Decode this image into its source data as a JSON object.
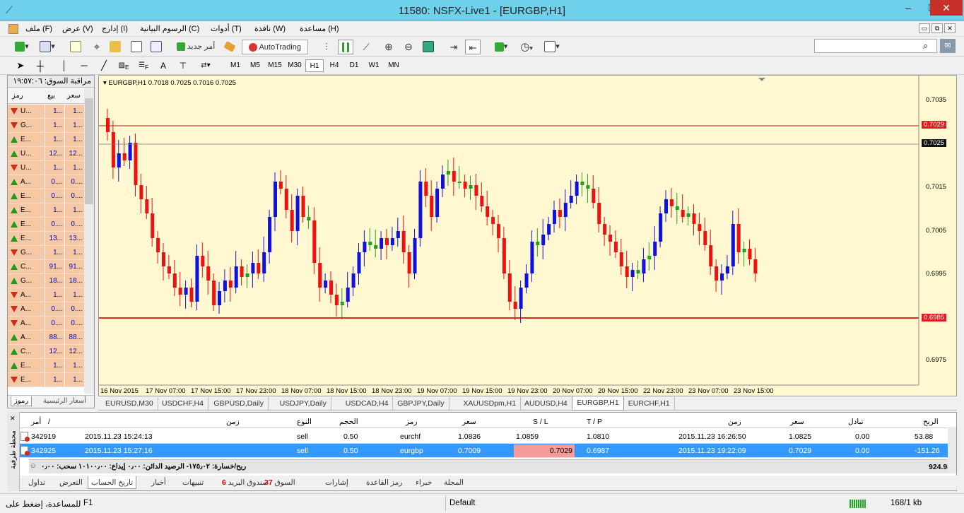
{
  "window": {
    "title": "11580: NSFX-Live1 - [EURGBP,H1]",
    "controls": [
      "–",
      "☐",
      "✕"
    ],
    "mdi_controls": [
      "▭",
      "⧉",
      "✕"
    ]
  },
  "menu": {
    "items": [
      "ملف (F)",
      "عرض (V)",
      "إدارج (I)",
      "الرسوم البيانية (C)",
      "أدوات (T)",
      "نافذة (W)",
      "مساعدة (H)"
    ]
  },
  "toolbar": {
    "new_order_label": "أمر جديد",
    "autotrading_label": "AutoTrading",
    "timeframes": [
      "M1",
      "M5",
      "M15",
      "M30",
      "H1",
      "H4",
      "D1",
      "W1",
      "MN"
    ],
    "selected_timeframe": "H1",
    "drawing_letters": [
      "E",
      "F",
      "A",
      "T"
    ]
  },
  "market_watch": {
    "header": "مراقبة السوق: ١٩:٥٧:٠٦",
    "columns": [
      "رمز",
      "بيع",
      "سعر"
    ],
    "rows": [
      {
        "sym": "U...",
        "bid": "1...",
        "ask": "1...",
        "dir": "dn"
      },
      {
        "sym": "G...",
        "bid": "1...",
        "ask": "1...",
        "dir": "dn"
      },
      {
        "sym": "E...",
        "bid": "1...",
        "ask": "1...",
        "dir": "up"
      },
      {
        "sym": "U...",
        "bid": "12...",
        "ask": "12...",
        "dir": "up"
      },
      {
        "sym": "U...",
        "bid": "1...",
        "ask": "1...",
        "dir": "dn"
      },
      {
        "sym": "A...",
        "bid": "0....",
        "ask": "0....",
        "dir": "up"
      },
      {
        "sym": "E...",
        "bid": "0....",
        "ask": "0....",
        "dir": "up"
      },
      {
        "sym": "E...",
        "bid": "1...",
        "ask": "1...",
        "dir": "up"
      },
      {
        "sym": "E...",
        "bid": "0....",
        "ask": "0....",
        "dir": "up"
      },
      {
        "sym": "E...",
        "bid": "13...",
        "ask": "13...",
        "dir": "up"
      },
      {
        "sym": "G...",
        "bid": "1...",
        "ask": "1...",
        "dir": "dn"
      },
      {
        "sym": "C...",
        "bid": "91...",
        "ask": "91...",
        "dir": "up"
      },
      {
        "sym": "G...",
        "bid": "18...",
        "ask": "18...",
        "dir": "up"
      },
      {
        "sym": "A...",
        "bid": "1...",
        "ask": "1...",
        "dir": "dn"
      },
      {
        "sym": "A...",
        "bid": "0....",
        "ask": "0....",
        "dir": "dn"
      },
      {
        "sym": "A...",
        "bid": "0....",
        "ask": "0....",
        "dir": "dn"
      },
      {
        "sym": "A...",
        "bid": "88...",
        "ask": "88...",
        "dir": "up"
      },
      {
        "sym": "C...",
        "bid": "12...",
        "ask": "12...",
        "dir": "up"
      },
      {
        "sym": "E...",
        "bid": "1...",
        "ask": "1...",
        "dir": "up"
      },
      {
        "sym": "E...",
        "bid": "1...",
        "ask": "1...",
        "dir": "dn"
      }
    ],
    "tabs": [
      "رموز",
      "أسعار الرئيسية"
    ]
  },
  "chart": {
    "header": "EURGBP,H1  0.7018 0.7025 0.7016 0.7025",
    "price_labels": [
      "0.7035",
      "0.7015",
      "0.7005",
      "0.6995",
      "0.6975"
    ],
    "level_sl": "0.7029",
    "level_current": "0.7025",
    "level_tp": "0.6985",
    "time_labels": [
      "16 Nov 2015",
      "17 Nov 07:00",
      "17 Nov 15:00",
      "17 Nov 23:00",
      "18 Nov 07:00",
      "18 Nov 15:00",
      "18 Nov 23:00",
      "19 Nov 07:00",
      "19 Nov 15:00",
      "19 Nov 23:00",
      "20 Nov 07:00",
      "20 Nov 15:00",
      "22 Nov 23:00",
      "23 Nov 07:00",
      "23 Nov 15:00"
    ],
    "colors": {
      "bull": "#1010e0",
      "bear": "#f01010",
      "doji": "#20a020",
      "bg": "#fff8d0",
      "level": "#d01010"
    }
  },
  "chart_tabs": [
    "EURUSD,M30",
    "USDCHF,H4",
    "GBPUSD,Daily",
    "USDJPY,Daily",
    "USDCAD,H4",
    "GBPJPY,Daily",
    "XAUUSDpm,H1",
    "AUDUSD,H4",
    "EURGBP,H1",
    "EURCHF,H1"
  ],
  "active_chart_tab": "EURGBP,H1",
  "terminal": {
    "columns": {
      "order": "أمر",
      "sort": "/",
      "time": "زمن",
      "type": "النوع",
      "volume": "الحجم",
      "symbol": "رمز",
      "price": "سعر",
      "sl": "S / L",
      "tp": "T / P",
      "time2": "زمن",
      "price2": "سعر",
      "swap": "تبادل",
      "profit": "الربح"
    },
    "rows": [
      {
        "order": "342919",
        "time": "2015.11.23 15:24:13",
        "type": "sell",
        "volume": "0.50",
        "symbol": "eurchf",
        "price": "1.0836",
        "sl": "1.0859",
        "tp": "1.0810",
        "time2": "2015.11.23 16:26:50",
        "price2": "1.0825",
        "swap": "0.00",
        "profit": "53.88"
      },
      {
        "order": "342925",
        "time": "2015.11.23 15:27:16",
        "type": "sell",
        "volume": "0.50",
        "symbol": "eurgbp",
        "price": "0.7009",
        "sl": "0.7029",
        "tp": "0.6987",
        "time2": "2015.11.23 19:22:09",
        "price2": "0.7029",
        "swap": "0.00",
        "profit": "-151.26"
      }
    ],
    "summary": "ربح/خسارة: ١٧٥٫٠٢- الرصيد الدائن: ٠٫٠٠  إيداع: ١٠١٠٠٫٠٠  سحب: ٠٫٠٠",
    "summary_total": "924.98",
    "side_label": "محطة طرفية",
    "tabs": [
      "تداول",
      "التعرض",
      "تاريخ الحساب",
      "أخبار",
      "تنبيهات",
      "صندوق البريد",
      "السوق",
      "إشارات",
      "رمز القاعدة",
      "خبراء",
      "المجلة"
    ],
    "tab_badges": {
      "mail": "6",
      "market": "37"
    },
    "active_tab": "تاريخ الحساب"
  },
  "status": {
    "help": "للمساعدة، إضغط على",
    "key": "F1",
    "profile": "Default",
    "traffic": "168/1 kb"
  }
}
